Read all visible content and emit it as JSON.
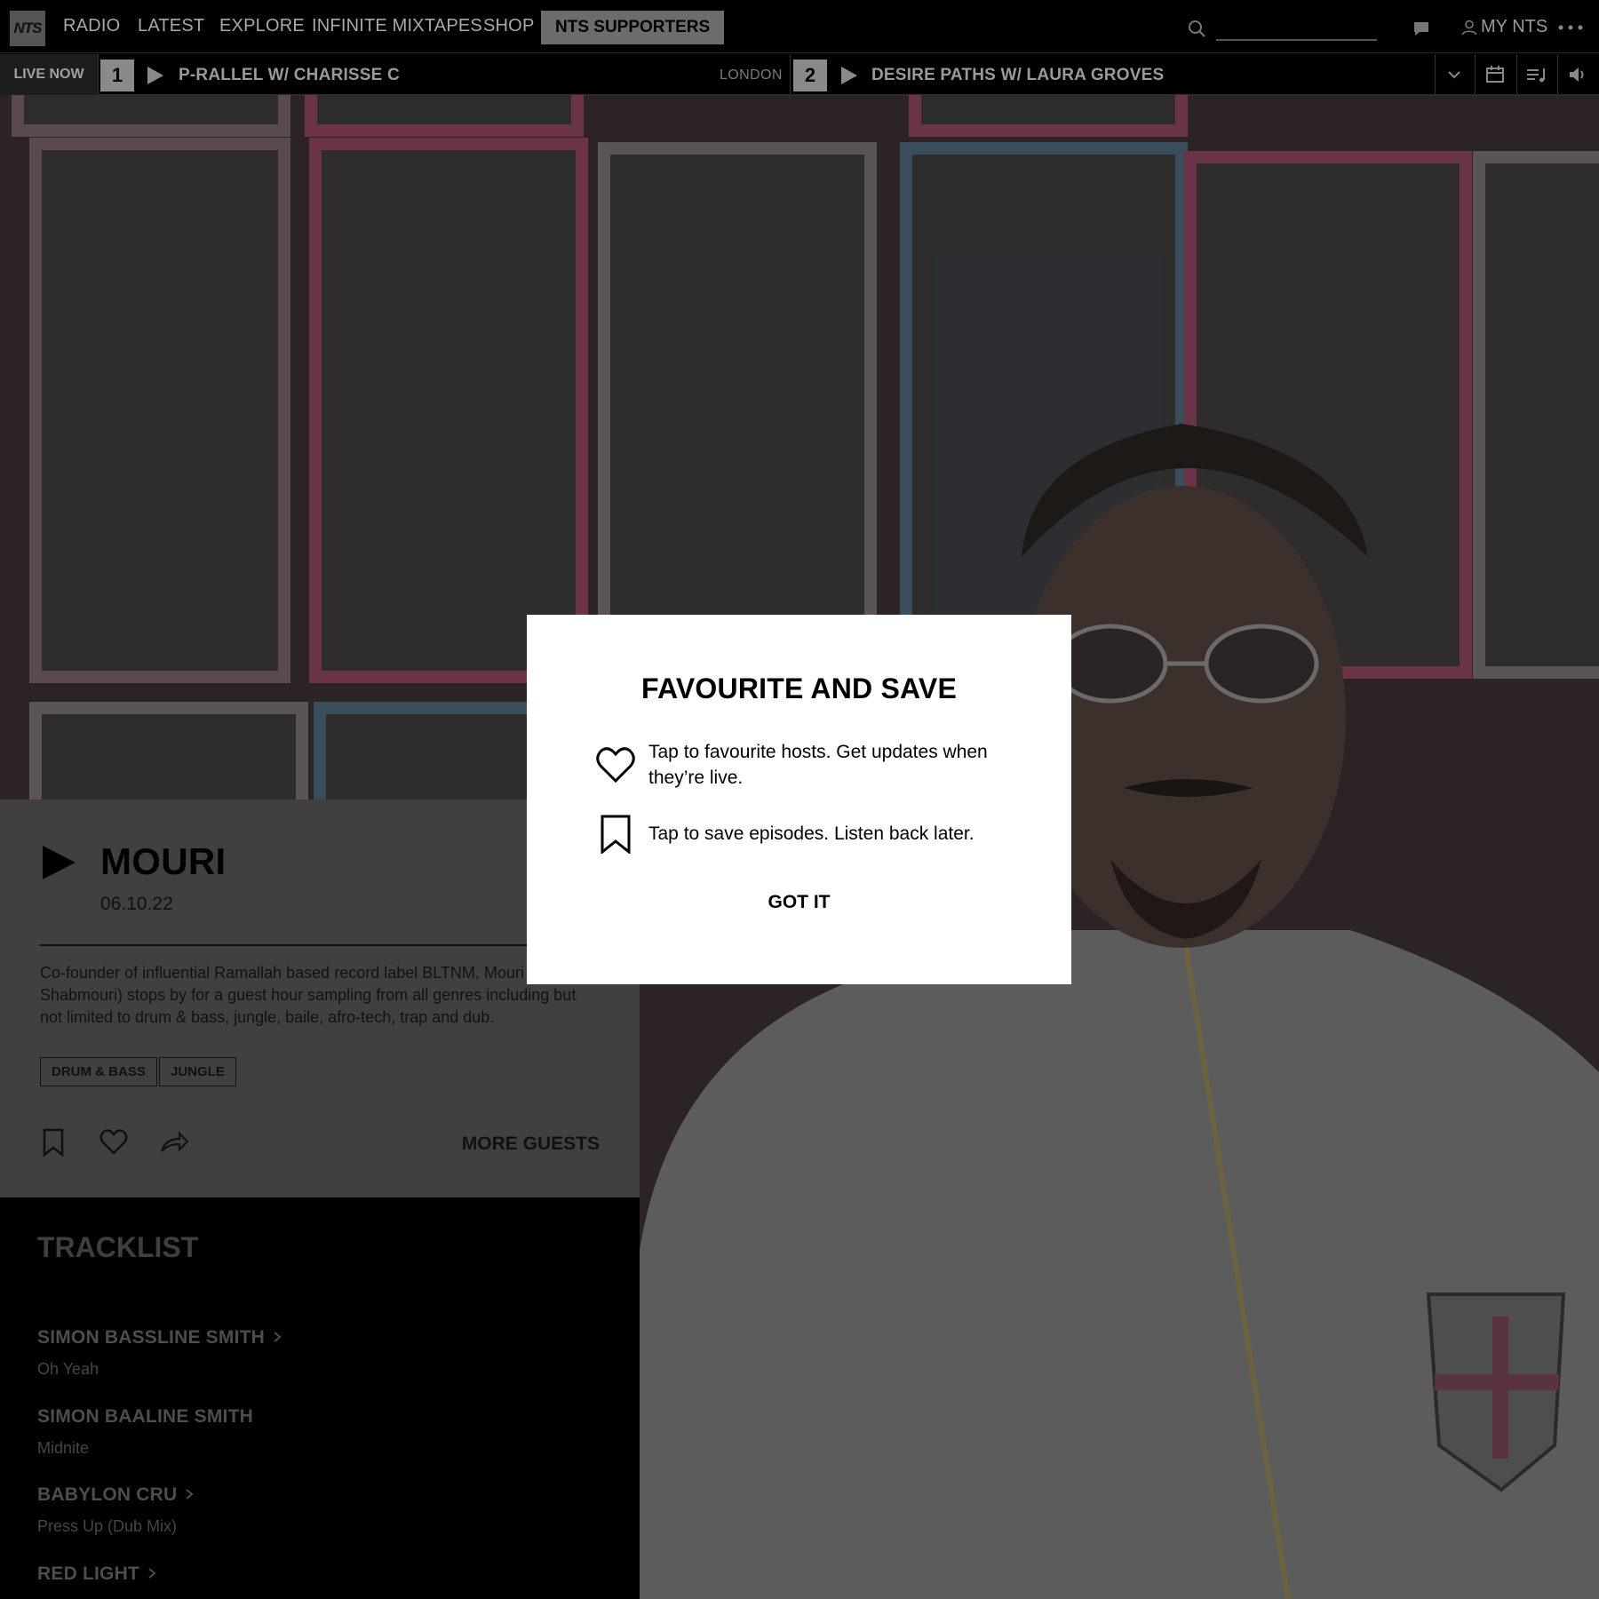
{
  "nav": {
    "logo": "NTS",
    "items": [
      "RADIO",
      "LATEST",
      "EXPLORE",
      "INFINITE MIXTAPES",
      "SHOP"
    ],
    "supporters": "NTS SUPPORTERS",
    "search": {
      "placeholder": ""
    },
    "my_nts": "MY NTS"
  },
  "live": {
    "label": "LIVE NOW",
    "channels": [
      {
        "number": "1",
        "title": "P-RALLEL W/ CHARISSE C",
        "location": "LONDON"
      },
      {
        "number": "2",
        "title": "DESIRE PATHS W/ LAURA GROVES",
        "location": ""
      }
    ]
  },
  "episode": {
    "title": "MOURI",
    "date": "06.10.22",
    "description": "Co-founder of influential Ramallah based record label BLTNM, Mouri (aka Shabmouri) stops by for a guest hour sampling from all genres including but not limited to drum & bass, jungle, baile, afro-tech, trap and dub.",
    "tags": [
      "DRUM & BASS",
      "JUNGLE"
    ],
    "more_guests": "MORE GUESTS"
  },
  "tracklist": {
    "title": "TRACKLIST",
    "tracks": [
      {
        "artist": "SIMON BASSLINE SMITH",
        "title": "Oh Yeah",
        "link": true
      },
      {
        "artist": "SIMON BAALINE SMITH",
        "title": "Midnite",
        "link": false
      },
      {
        "artist": "BABYLON CRU",
        "title": "Press Up (Dub Mix)",
        "link": true
      },
      {
        "artist": "RED LIGHT",
        "title": "",
        "link": true
      }
    ]
  },
  "modal": {
    "title": "FAVOURITE AND SAVE",
    "favourite_text": "Tap to favourite hosts. Get updates when they’re live.",
    "save_text": "Tap to save episodes. Listen back later.",
    "button": "GOT IT"
  },
  "icons": [
    "search-icon",
    "chat-icon",
    "user-icon",
    "more-icon",
    "play-icon",
    "chevron-down-icon",
    "schedule-icon",
    "playlist-icon",
    "volume-icon",
    "bookmark-icon",
    "heart-icon",
    "share-icon",
    "chevron-right-icon"
  ],
  "colors": {
    "overlay": "#000000",
    "modal_bg": "#ffffff",
    "supporters_bg": "#6c6c6c"
  }
}
